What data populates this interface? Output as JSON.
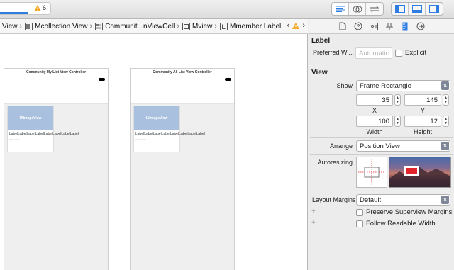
{
  "toolbar": {
    "warning_count": "6",
    "progress_fraction": 0.55
  },
  "jumpbar": {
    "crumbs": [
      {
        "label": "View",
        "icon": "view-icon"
      },
      {
        "label": "Mcollection View",
        "icon": "collection-view-icon"
      },
      {
        "label": "Communit...nViewCell",
        "icon": "collection-cell-icon"
      },
      {
        "label": "Mview",
        "icon": "view-icon"
      },
      {
        "label": "Mmember Label",
        "icon": "label-icon"
      }
    ]
  },
  "canvas": {
    "scenes": [
      {
        "title": "Community My List View Controller",
        "image_label": "UIImageView",
        "cell_text": "LabelLabelLabelLabelLabelLabelLabelLabel",
        "cell_sub": "----- -----"
      },
      {
        "title": "Community All List View Controller",
        "image_label": "UIImageView",
        "cell_text": "LabelLabelLabelLabelLabelLabelLabelLabel",
        "cell_sub": "----- -----"
      }
    ]
  },
  "inspector": {
    "label_section": {
      "title": "Label",
      "preferred_width_label": "Preferred Wi...",
      "preferred_width_placeholder": "Automatic",
      "explicit_label": "Explicit"
    },
    "view_section": {
      "title": "View",
      "show_label": "Show",
      "show_value": "Frame Rectangle",
      "x_value": "35",
      "y_value": "145",
      "x_caption": "X",
      "y_caption": "Y",
      "width_value": "100",
      "height_value": "12",
      "width_caption": "Width",
      "height_caption": "Height",
      "arrange_label": "Arrange",
      "arrange_value": "Position View",
      "autoresizing_label": "Autoresizing",
      "layout_margins_label": "Layout Margins",
      "layout_margins_value": "Default",
      "preserve_superview_label": "Preserve Superview Margins",
      "follow_readable_label": "Follow Readable Width"
    }
  },
  "colors": {
    "accent": "#2f7de1",
    "autoresize_red": "#e0262a",
    "image_placeholder": "#a9c1de"
  }
}
